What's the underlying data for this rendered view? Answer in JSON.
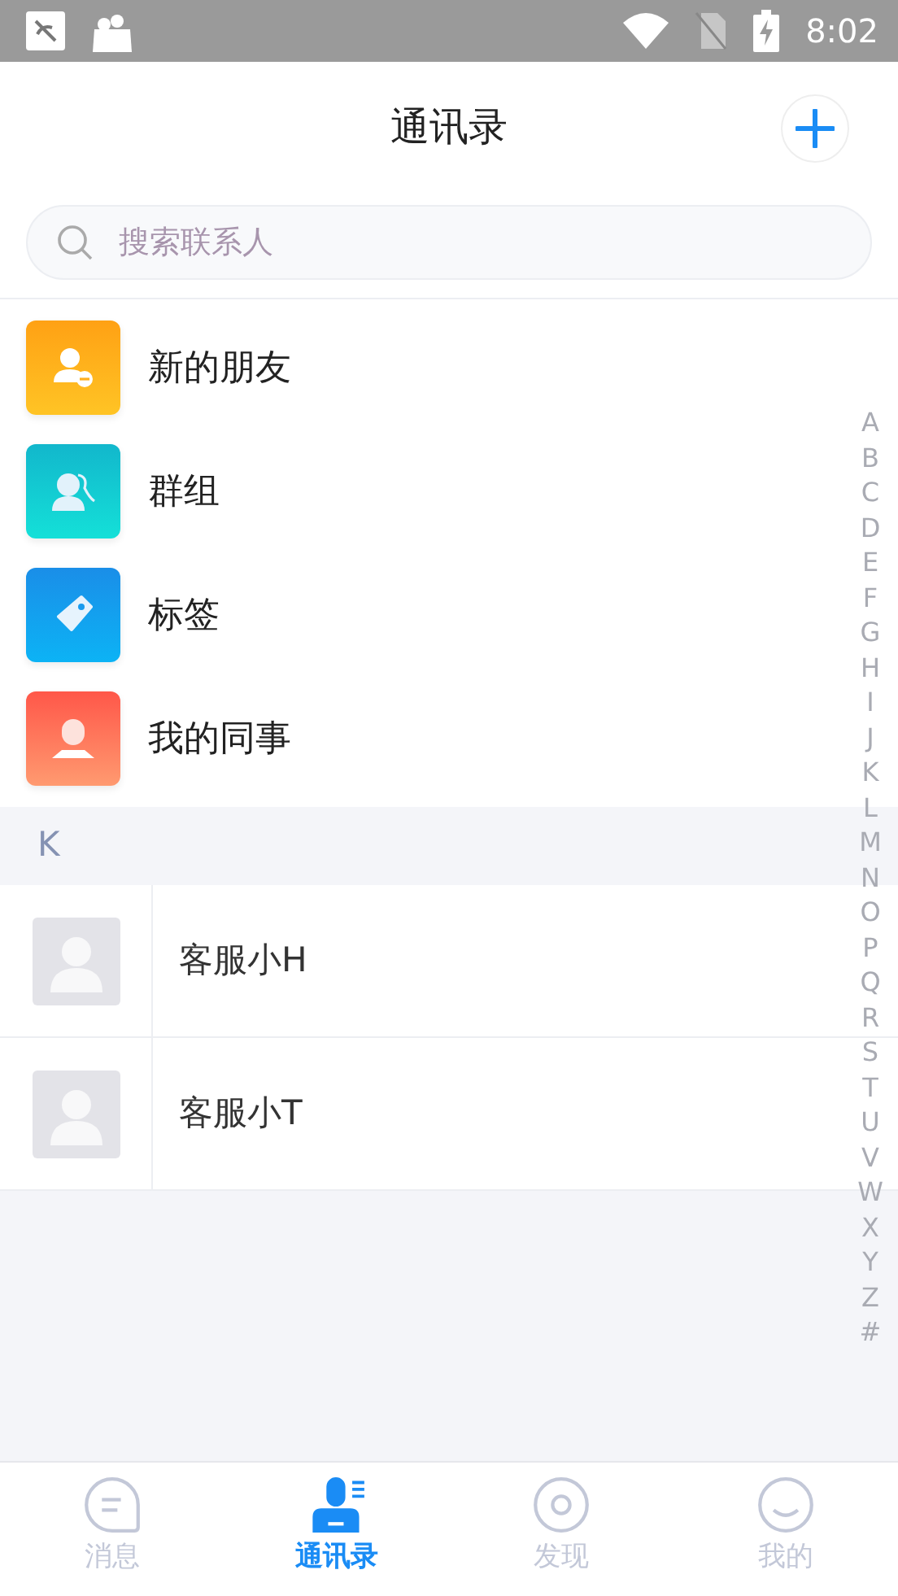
{
  "status_bar": {
    "time": "8:02"
  },
  "header": {
    "title": "通讯录"
  },
  "search": {
    "placeholder": "搜索联系人"
  },
  "menu": [
    {
      "label": "新的朋友",
      "kind": "new-friend"
    },
    {
      "label": "群组",
      "kind": "group"
    },
    {
      "label": "标签",
      "kind": "tag"
    },
    {
      "label": "我的同事",
      "kind": "colleague"
    }
  ],
  "sections": [
    {
      "letter": "K",
      "contacts": [
        {
          "name": "客服小H"
        },
        {
          "name": "客服小T"
        }
      ]
    }
  ],
  "index_bar": [
    "A",
    "B",
    "C",
    "D",
    "E",
    "F",
    "G",
    "H",
    "I",
    "J",
    "K",
    "L",
    "M",
    "N",
    "O",
    "P",
    "Q",
    "R",
    "S",
    "T",
    "U",
    "V",
    "W",
    "X",
    "Y",
    "Z",
    "#"
  ],
  "tabs": [
    {
      "label": "消息",
      "kind": "chat",
      "selected": false
    },
    {
      "label": "通讯录",
      "kind": "contacts",
      "selected": true
    },
    {
      "label": "发现",
      "kind": "discover",
      "selected": false
    },
    {
      "label": "我的",
      "kind": "me",
      "selected": false
    }
  ]
}
